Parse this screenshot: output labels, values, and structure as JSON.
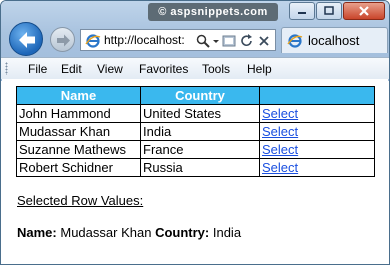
{
  "browser": {
    "watermark": "© aspsnippets.com",
    "address": "http://localhost:",
    "tab_title": "localhost"
  },
  "menu": [
    "File",
    "Edit",
    "View",
    "Favorites",
    "Tools",
    "Help"
  ],
  "grid": {
    "headers": [
      "Name",
      "Country",
      ""
    ],
    "rows": [
      {
        "name": "John Hammond",
        "country": "United States",
        "action": "Select"
      },
      {
        "name": "Mudassar Khan",
        "country": "India",
        "action": "Select"
      },
      {
        "name": "Suzanne Mathews",
        "country": "France",
        "action": "Select"
      },
      {
        "name": "Robert Schidner",
        "country": "Russia",
        "action": "Select"
      }
    ],
    "header_color": "#3ab8ee"
  },
  "selection": {
    "heading": "Selected Row Values:",
    "name_label": "Name:",
    "name_value": "Mudassar Khan",
    "country_label": "Country:",
    "country_value": "India"
  }
}
